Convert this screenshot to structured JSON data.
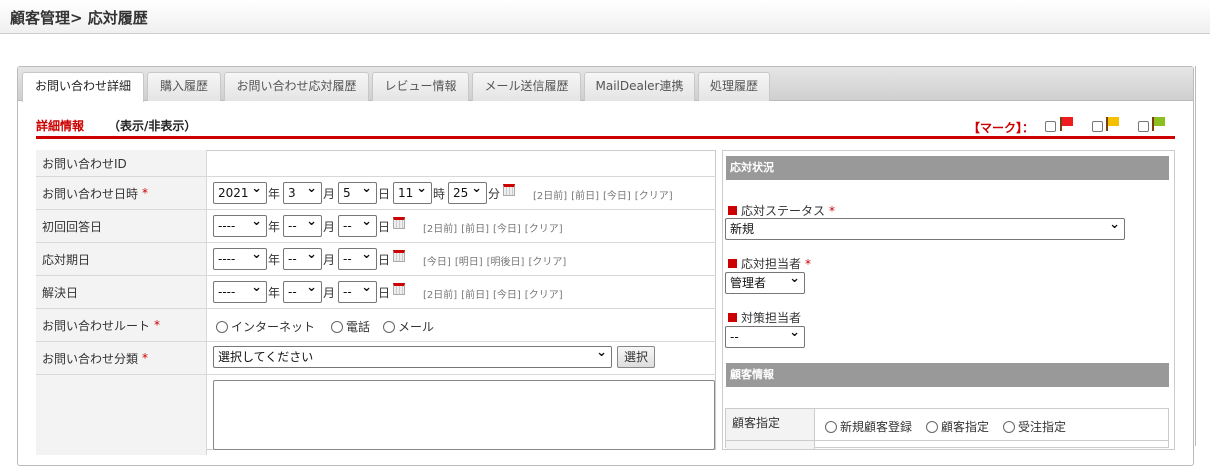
{
  "header": {
    "title": "顧客管理> 応対履歴"
  },
  "tabs": [
    "お問い合わせ詳細",
    "購入履歴",
    "お問い合わせ応対履歴",
    "レビュー情報",
    "メール送信履歴",
    "MailDealer連携",
    "処理履歴"
  ],
  "section": {
    "title": "詳細情報",
    "toggle": "（表示/非表示）"
  },
  "mark": {
    "label": "【マーク】：",
    "flags": [
      {
        "name": "red",
        "color": "#ee1c1c"
      },
      {
        "name": "yellow",
        "color": "#f5c000"
      },
      {
        "name": "green",
        "color": "#8cbf1f"
      }
    ]
  },
  "form": {
    "inquiry_id": {
      "label": "お問い合わせID",
      "value": ""
    },
    "inquiry_datetime": {
      "label": "お問い合わせ日時",
      "required": "*",
      "year": "2021",
      "month": "3",
      "day": "5",
      "hour": "11",
      "minute": "25",
      "links": [
        "[2日前]",
        "[前日]",
        "[今日]",
        "[クリア]"
      ]
    },
    "first_reply": {
      "label": "初回回答日",
      "year": "----",
      "month": "--",
      "day": "--",
      "links": [
        "[2日前]",
        "[前日]",
        "[今日]",
        "[クリア]"
      ]
    },
    "due_date": {
      "label": "応対期日",
      "year": "----",
      "month": "--",
      "day": "--",
      "links": [
        "[今日]",
        "[明日]",
        "[明後日]",
        "[クリア]"
      ]
    },
    "resolved": {
      "label": "解決日",
      "year": "----",
      "month": "--",
      "day": "--",
      "links": [
        "[2日前]",
        "[前日]",
        "[今日]",
        "[クリア]"
      ]
    },
    "route": {
      "label": "お問い合わせルート",
      "required": "*",
      "options": [
        "インターネット",
        "電話",
        "メール"
      ]
    },
    "category": {
      "label": "お問い合わせ分類",
      "required": "*",
      "value": "選択してください",
      "button": "選択"
    }
  },
  "units": {
    "year": "年",
    "month": "月",
    "day": "日",
    "hour": "時",
    "minute": "分"
  },
  "status_panel": {
    "title": "応対状況",
    "status_label": "応対ステータス",
    "status_value": "新規",
    "assignee_label": "応対担当者",
    "assignee_value": "管理者",
    "measure_label": "対策担当者",
    "measure_value": "--",
    "required": "*"
  },
  "customer_panel": {
    "title": "顧客情報",
    "designation_label": "顧客指定",
    "options": [
      "新規顧客登録",
      "顧客指定",
      "受注指定"
    ]
  }
}
